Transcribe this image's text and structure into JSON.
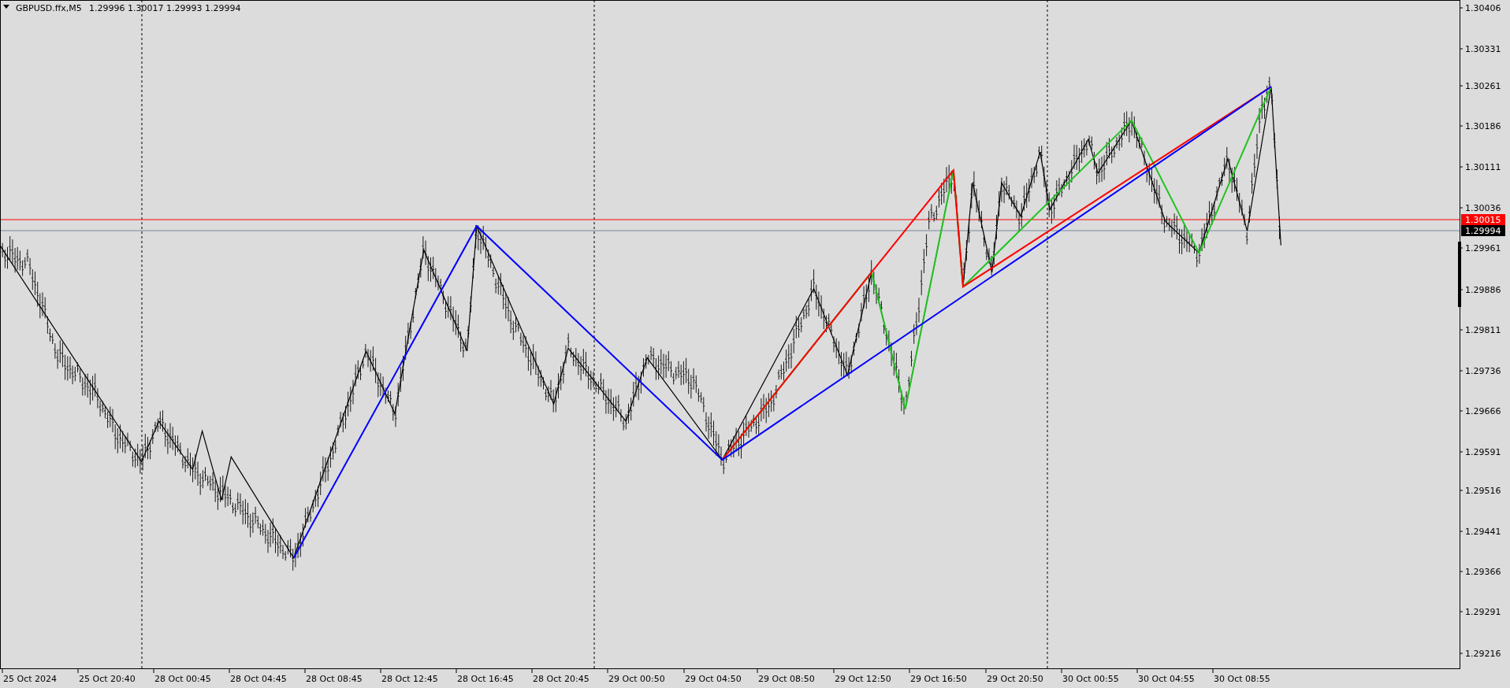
{
  "header": {
    "symbol": "GBPUSD.ffx,M5",
    "quotes": [
      "1.29996",
      "1.30017",
      "1.29993",
      "1.29994"
    ]
  },
  "price_axis": [
    "1.30406",
    "1.30331",
    "1.30261",
    "1.30186",
    "1.30111",
    "1.30036",
    "1.29961",
    "1.29886",
    "1.29811",
    "1.29736",
    "1.29666",
    "1.29591",
    "1.29516",
    "1.29441",
    "1.29366",
    "1.29291",
    "1.29216"
  ],
  "price_tags": [
    {
      "text": "1.30015",
      "color": "#ff0000"
    },
    {
      "text": "1.29994",
      "color": "#000000"
    }
  ],
  "time_axis": [
    "25 Oct 2024",
    "25 Oct 20:40",
    "28 Oct 00:45",
    "28 Oct 04:45",
    "28 Oct 08:45",
    "28 Oct 12:45",
    "28 Oct 16:45",
    "28 Oct 20:45",
    "29 Oct 00:50",
    "29 Oct 04:50",
    "29 Oct 08:50",
    "29 Oct 12:50",
    "29 Oct 16:50",
    "29 Oct 20:50",
    "30 Oct 00:55",
    "30 Oct 04:55",
    "30 Oct 08:55"
  ]
}
